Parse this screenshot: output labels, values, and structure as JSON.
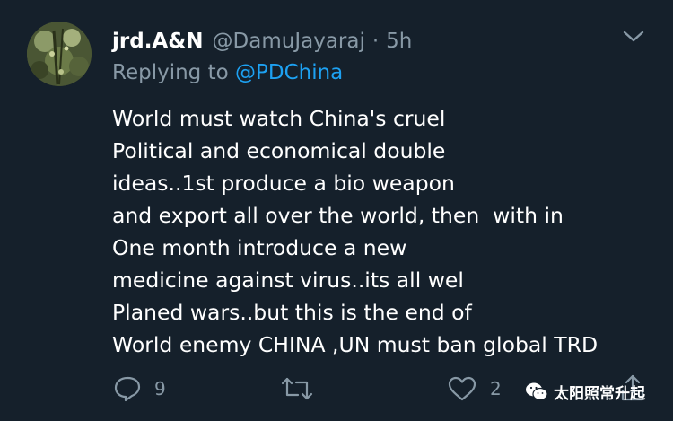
{
  "tweet": {
    "display_name": "jrd.A&N",
    "handle": "@DamuJayaraj",
    "separator": "·",
    "time": "5h",
    "reply_prefix": "Replying to",
    "reply_mention": "@PDChina",
    "body_lines": [
      "World must watch China's cruel",
      "Political and economical double",
      "ideas..1st produce a bio weapon",
      "and export all over the world, then  with in",
      "One month introduce a new",
      "medicine against virus..its all wel",
      "Planed wars..but this is the end of",
      "World enemy CHINA ,UN must ban global TRD"
    ],
    "actions": {
      "reply_count": "9",
      "like_count": "2"
    }
  },
  "icons": {
    "avatar": "profile-photo",
    "caret": "chevron-down-icon",
    "reply": "comment-icon",
    "retweet": "retweet-icon",
    "like": "heart-icon",
    "share": "share-icon",
    "watermark_logo": "wechat-logo"
  },
  "watermark": {
    "text": "太阳照常升起"
  },
  "colors": {
    "background": "#15202b",
    "secondary_text": "#8899a6",
    "link": "#1da1f2",
    "primary_text": "#ffffff"
  }
}
